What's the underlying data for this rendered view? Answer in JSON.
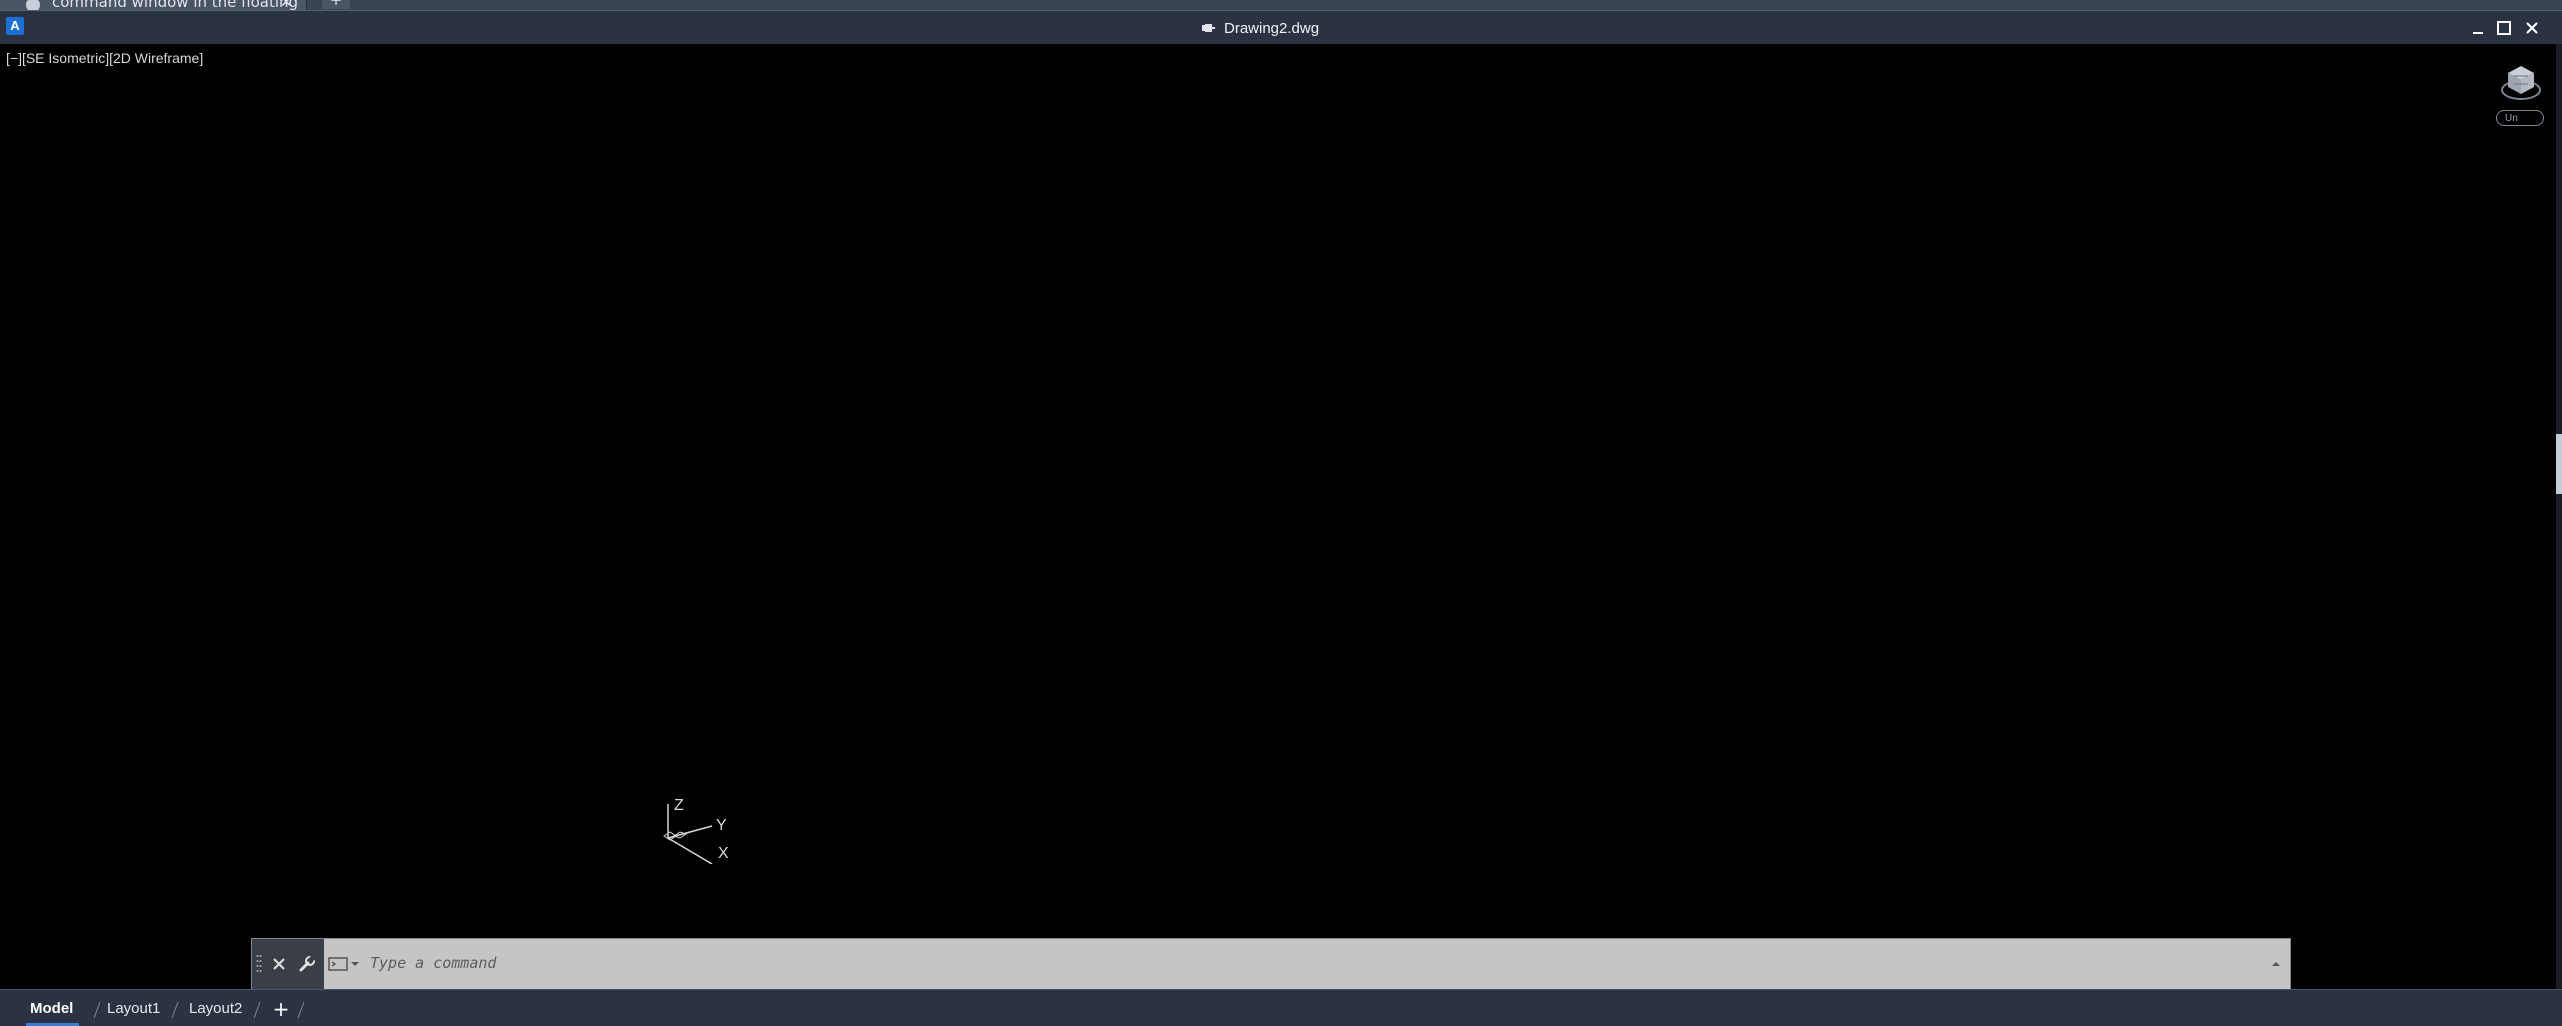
{
  "tabstrip": {
    "active_tab_label": "command window in the floating",
    "close_label": "✕",
    "add_label": "+"
  },
  "titlebar": {
    "app_icon_letter": "A",
    "document_title": "Drawing2.dwg",
    "minimize_label": "minimize",
    "maximize_label": "maximize",
    "close_label": "close"
  },
  "viewport": {
    "controls_label": "[−][SE Isometric][2D Wireframe]",
    "ucs_pill_label": "Un",
    "ucs_axes": {
      "z": "Z",
      "y": "Y",
      "x": "X"
    }
  },
  "command_line": {
    "placeholder": "Type a command"
  },
  "layout_tabs": {
    "items": [
      "Model",
      "Layout1",
      "Layout2"
    ],
    "active": "Model",
    "add_label": "+"
  },
  "colors": {
    "viewport_bg": "#000000",
    "chrome_bg": "#2b3342",
    "command_bg": "#c5c5c5",
    "accent": "#1d6fd6"
  }
}
